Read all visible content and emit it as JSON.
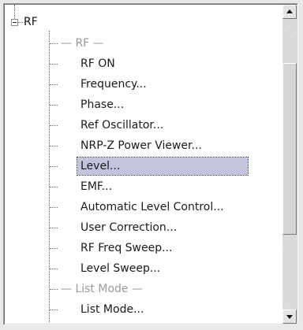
{
  "tree": {
    "root_label": "RF",
    "items": [
      {
        "label": "— RF —",
        "kind": "separator"
      },
      {
        "label": "RF ON",
        "kind": "item"
      },
      {
        "label": "Frequency...",
        "kind": "item"
      },
      {
        "label": "Phase...",
        "kind": "item"
      },
      {
        "label": "Ref Oscillator...",
        "kind": "item"
      },
      {
        "label": "NRP-Z Power Viewer...",
        "kind": "item"
      },
      {
        "label": "Level...",
        "kind": "item",
        "selected": true
      },
      {
        "label": "EMF...",
        "kind": "item"
      },
      {
        "label": "Automatic Level Control...",
        "kind": "item"
      },
      {
        "label": "User Correction...",
        "kind": "item"
      },
      {
        "label": "RF Freq Sweep...",
        "kind": "item"
      },
      {
        "label": "Level Sweep...",
        "kind": "item"
      },
      {
        "label": "— List Mode —",
        "kind": "separator"
      },
      {
        "label": "List Mode...",
        "kind": "item"
      }
    ]
  },
  "scrollbar": {
    "up_icon": "triangle-up-icon",
    "down_icon": "triangle-down-icon"
  },
  "colors": {
    "selection": "#c3c3dd",
    "separator_text": "#9a9a9a",
    "text": "#1a1a1a"
  }
}
